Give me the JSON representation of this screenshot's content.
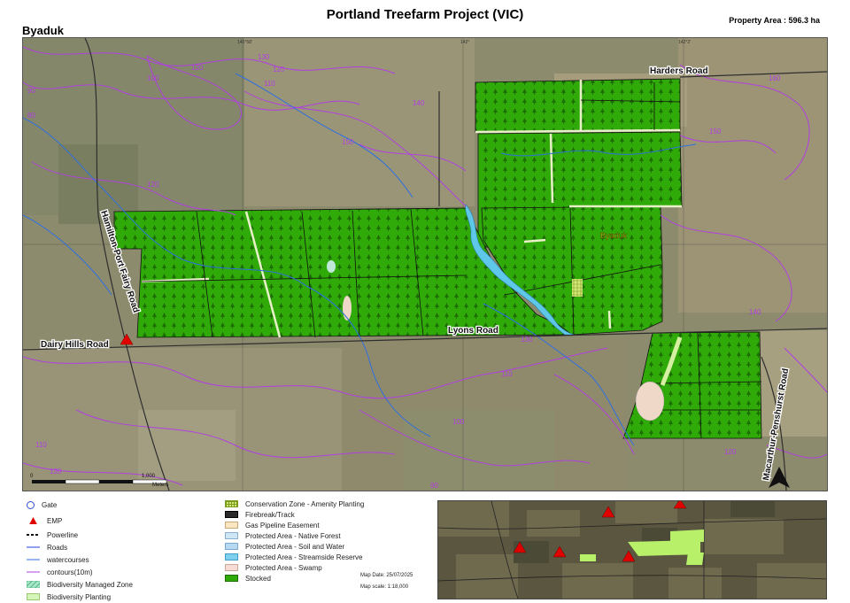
{
  "map": {
    "title": "Portland Treefarm Project (VIC)",
    "property_area": "Property Area : 596.3 ha",
    "region_name": "Byaduk",
    "place_label": "Byaduk",
    "roads": {
      "harders": "Harders Road",
      "hamilton": "Hamilton-Port Fairy Road",
      "dairy_hills": "Dairy Hills Road",
      "lyons": "Lyons Road",
      "macarthur": "Macarthur-Penshurst Road"
    },
    "contour_labels": [
      "120",
      "130",
      "120",
      "110",
      "100",
      "140",
      "150",
      "120",
      "90",
      "80",
      "150",
      "140",
      "130",
      "110",
      "100",
      "90",
      "120",
      "110",
      "120",
      "160"
    ],
    "grid_labels_top": [
      "141°58'",
      "142°",
      "142°2'"
    ],
    "grid_labels_left": [
      "37°58'"
    ],
    "scale_bar": {
      "start": "0",
      "end": "1,000",
      "unit": "Meters"
    },
    "colors": {
      "stocked": "#2faa08",
      "contour": "#b040e0",
      "watercourse": "#2f6fe0",
      "road": "#6a7fe8",
      "emp": "#e00000",
      "streamside": "#5fc8e8"
    }
  },
  "legend": {
    "col1": [
      {
        "label": "Gate",
        "icon": "gate-icon"
      },
      {
        "label": "EMP",
        "icon": "emp-triangle-icon"
      },
      {
        "label": "Powerline",
        "icon": "powerline-icon"
      },
      {
        "label": "Roads",
        "icon": "roads-line-icon"
      },
      {
        "label": "watercourses",
        "icon": "watercourse-line-icon"
      },
      {
        "label": "contours(10m)",
        "icon": "contour-line-icon"
      },
      {
        "label": "Biodiversity Managed Zone",
        "icon": "biodiversity-managed-swatch"
      },
      {
        "label": "Biodiversity Planting",
        "icon": "biodiversity-planting-swatch"
      }
    ],
    "col2": [
      {
        "label": "Conservation Zone - Amenity Planting",
        "icon": "amenity-swatch"
      },
      {
        "label": "Firebreak/Track",
        "icon": "firebreak-swatch"
      },
      {
        "label": "Gas Pipeline Easement",
        "icon": "gas-pipeline-swatch"
      },
      {
        "label": "Protected Area - Native Forest",
        "icon": "native-forest-swatch"
      },
      {
        "label": "Protected Area - Soil and Water",
        "icon": "soil-water-swatch"
      },
      {
        "label": "Protected Area - Streamside Reserve",
        "icon": "streamside-swatch"
      },
      {
        "label": "Protected Area - Swamp",
        "icon": "swamp-swatch"
      },
      {
        "label": "Stocked",
        "icon": "stocked-swatch"
      }
    ]
  },
  "meta": {
    "date": "Map Date: 25/07/2025",
    "scale": "Map scale: 1:18,000"
  }
}
